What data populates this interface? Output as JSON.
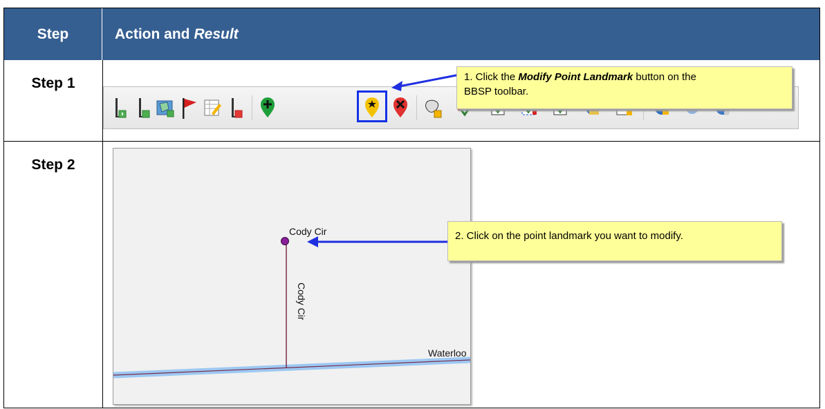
{
  "header": {
    "col_step": "Step",
    "col_action_prefix": "Action and",
    "col_action_italic": "Result"
  },
  "rows": [
    {
      "label": "Step 1",
      "callout": {
        "number": "1. Click the",
        "bold": "Modify Point Landmark",
        "rest": "button on the",
        "line2": "BBSP toolbar."
      }
    },
    {
      "label": "Step 2",
      "callout": {
        "text": "2. Click on the point landmark you want to modify."
      },
      "map": {
        "point_label": "Cody Cir",
        "vertical_label": "Cody Cir",
        "road_label": "Waterloo"
      }
    }
  ],
  "toolbar_icons": [
    "add-line-icon",
    "add-line-icon",
    "add-area-icon",
    "red-flag-icon",
    "edit-table-icon",
    "delete-line-icon",
    "add-point-landmark-icon",
    "modify-point-landmark-icon",
    "delete-point-landmark-icon",
    "area-tool-icon",
    "validate-icon",
    "check-icon",
    "check-icon",
    "check-icon",
    "globe-icon",
    "folder-icon",
    "globe-icon",
    "globe-icon",
    "globe-icon"
  ],
  "colors": {
    "header_bg": "#365f91",
    "callout_bg": "#ffff99",
    "arrow": "#1f2fe0",
    "highlight_box": "#1330e8"
  }
}
